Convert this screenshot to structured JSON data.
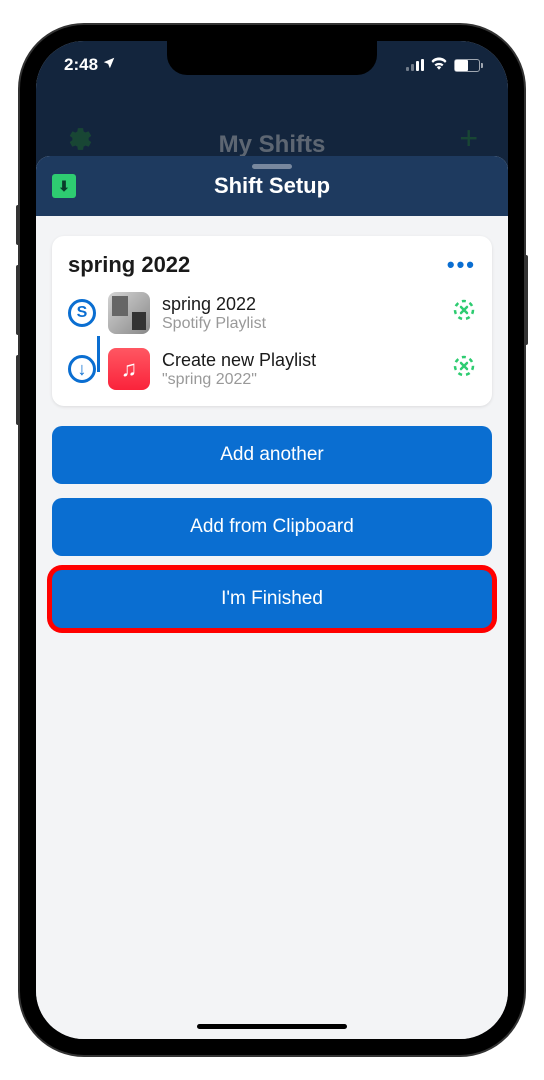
{
  "status": {
    "time": "2:48"
  },
  "background": {
    "title": "My Shifts"
  },
  "sheet": {
    "title": "Shift Setup",
    "card": {
      "title": "spring 2022",
      "source": {
        "title": "spring 2022",
        "subtitle": "Spotify Playlist"
      },
      "destination": {
        "title": "Create new Playlist",
        "subtitle": "\"spring 2022\""
      }
    },
    "buttons": {
      "add_another": "Add another",
      "add_clipboard": "Add from Clipboard",
      "finished": "I'm Finished"
    }
  }
}
